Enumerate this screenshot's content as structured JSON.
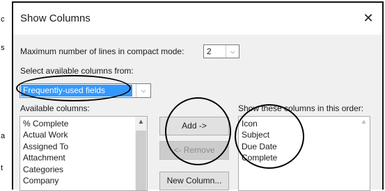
{
  "background_fragments": [
    "c",
    "s",
    "a",
    "t"
  ],
  "dialog": {
    "title": "Show Columns",
    "close_glyph": "✕",
    "max_lines_label": "Maximum number of lines in compact mode:",
    "max_lines_value": "2",
    "select_from_label": "Select available columns from:",
    "field_set": "Frequently-used fields",
    "available_label": "Available columns:",
    "available_columns": [
      "% Complete",
      "Actual Work",
      "Assigned To",
      "Attachment",
      "Categories",
      "Company"
    ],
    "show_label": "Show these columns in this order:",
    "shown_columns": [
      "Icon",
      "Subject",
      "Due Date",
      "Complete"
    ],
    "buttons": {
      "add": "Add ->",
      "remove": "<- Remove",
      "new_column": "New Column..."
    }
  },
  "icons": {
    "dropdown": "chevron-down-icon",
    "scroll_up": "scroll-up-arrow-icon"
  },
  "colors": {
    "selection": "#3399ff",
    "dialog_bg": "#f0f0f0",
    "annotation": "#000000"
  }
}
